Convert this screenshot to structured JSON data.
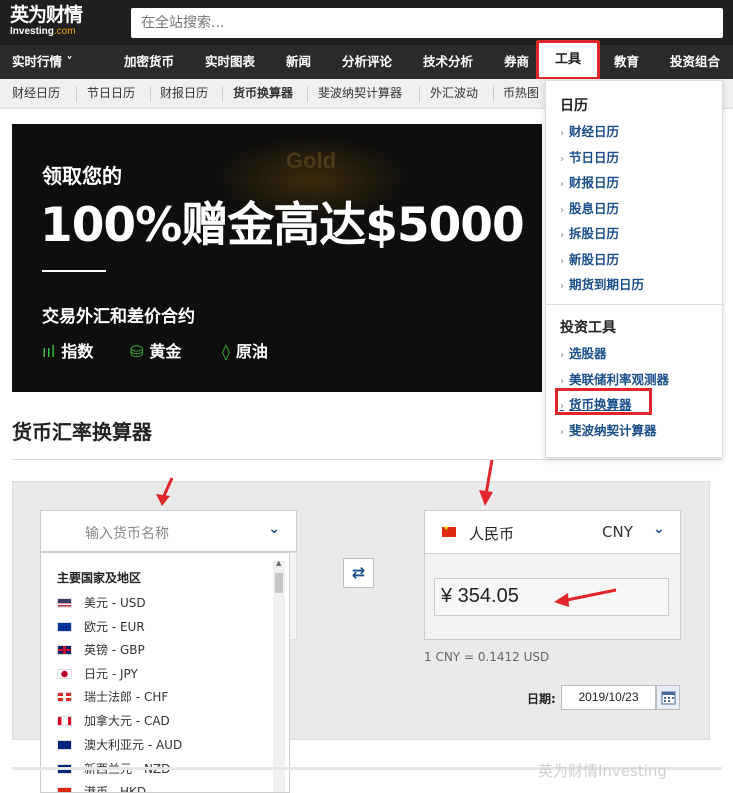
{
  "header": {
    "logo_cn": "英为财情",
    "logo_en": "Investing",
    "logo_com": ".com",
    "search_placeholder": "在全站搜索..."
  },
  "main_nav": [
    {
      "label": "实时行情 ˅"
    },
    {
      "label": "加密货币"
    },
    {
      "label": "实时图表"
    },
    {
      "label": "新闻"
    },
    {
      "label": "分析评论"
    },
    {
      "label": "技术分析"
    },
    {
      "label": "券商"
    },
    {
      "label": "工具"
    },
    {
      "label": "教育"
    },
    {
      "label": "投资组合"
    }
  ],
  "sub_nav": [
    {
      "label": "财经日历"
    },
    {
      "label": "节日日历"
    },
    {
      "label": "财报日历"
    },
    {
      "label": "货币换算器"
    },
    {
      "label": "斐波纳契计算器"
    },
    {
      "label": "外汇波动"
    },
    {
      "label": "币热图"
    }
  ],
  "banner": {
    "watermark_word": "Gold",
    "line1": "领取您的",
    "line2": "100%赠金高达$5000",
    "line3": "交易外汇和差价合约",
    "features": [
      {
        "icon": "bar-chart-icon",
        "glyph": "ııl",
        "label": "指数"
      },
      {
        "icon": "gold-bars-icon",
        "glyph": "⛁",
        "label": "黄金"
      },
      {
        "icon": "oil-drop-icon",
        "glyph": "◊",
        "label": "原油"
      }
    ]
  },
  "tools_menu": {
    "section1": "日历",
    "section1_items": [
      "财经日历",
      "节日日历",
      "财报日历",
      "股息日历",
      "拆股日历",
      "新股日历",
      "期货到期日历"
    ],
    "section2": "投资工具",
    "section2_items": [
      "选股器",
      "美联储利率观测器",
      "货币换算器",
      "斐波纳契计算器"
    ]
  },
  "page": {
    "title": "货币汇率换算器"
  },
  "converter": {
    "from_placeholder": "输入货币名称",
    "to_currency_name": "人民币",
    "to_currency_code": "CNY",
    "to_amount": "¥ 354.05",
    "rate_text": "1 CNY = 0.1412 USD",
    "date_label": "日期:",
    "date_value": "2019/10/23",
    "swap_glyph": "⇄",
    "chevron": "⌄"
  },
  "currency_list": {
    "group": "主要国家及地区",
    "items": [
      {
        "label": "美元 - USD",
        "flag": "us"
      },
      {
        "label": "欧元 - EUR",
        "flag": "eu"
      },
      {
        "label": "英镑 - GBP",
        "flag": "gb"
      },
      {
        "label": "日元 - JPY",
        "flag": "jp"
      },
      {
        "label": "瑞士法郎 - CHF",
        "flag": "ch"
      },
      {
        "label": "加拿大元 - CAD",
        "flag": "ca"
      },
      {
        "label": "澳大利亚元 - AUD",
        "flag": "au"
      },
      {
        "label": "新西兰元 - NZD",
        "flag": "nz"
      },
      {
        "label": "港币 - HKD",
        "flag": "hk"
      }
    ]
  },
  "colors": {
    "annotation_red": "#e0262b",
    "link_blue": "#1a4f8a",
    "header_bg": "#1f1f1f",
    "accent_orange": "#f7a21b"
  },
  "watermark": "英为财情Investing"
}
